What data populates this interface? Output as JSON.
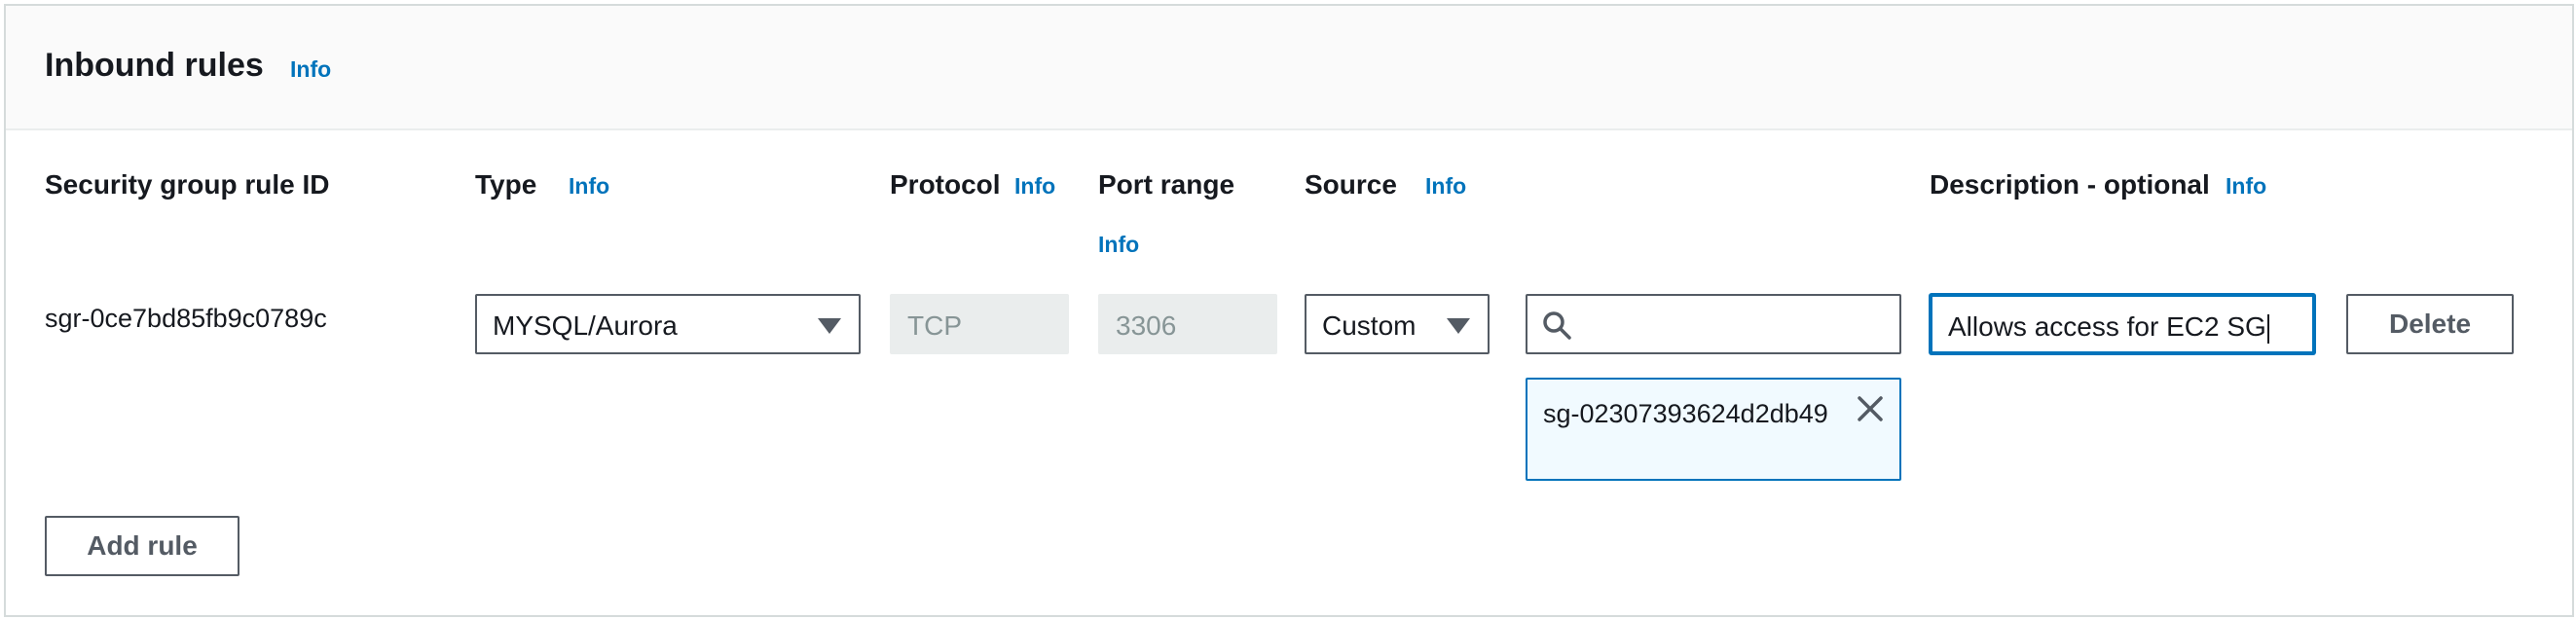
{
  "panel": {
    "title": "Inbound rules",
    "title_info": "Info"
  },
  "columns": {
    "rule_id": "Security group rule ID",
    "type": "Type",
    "type_info": "Info",
    "protocol": "Protocol",
    "protocol_info": "Info",
    "port_range": "Port range",
    "port_range_info": "Info",
    "source": "Source",
    "source_info": "Info",
    "description": "Description - optional",
    "description_info": "Info"
  },
  "rule": {
    "rule_id": "sgr-0ce7bd85fb9c0789c",
    "type_value": "MYSQL/Aurora",
    "protocol_value": "TCP",
    "port_range_value": "3306",
    "source_value": "Custom",
    "source_search_value": "",
    "source_token": "sg-02307393624d2db49",
    "description_value": "Allows access for EC2 SG",
    "delete_label": "Delete"
  },
  "actions": {
    "add_rule_label": "Add rule"
  },
  "icons": {
    "type_caret": "caret-down-icon",
    "source_caret": "caret-down-icon",
    "search": "search-icon",
    "token_remove": "close-icon"
  },
  "colors": {
    "link_info": "#0073bb",
    "focus_border": "#0073bb",
    "token_bg": "#f1faff",
    "disabled_bg": "#eaeded",
    "disabled_text": "#879596",
    "button_border": "#545b64"
  }
}
